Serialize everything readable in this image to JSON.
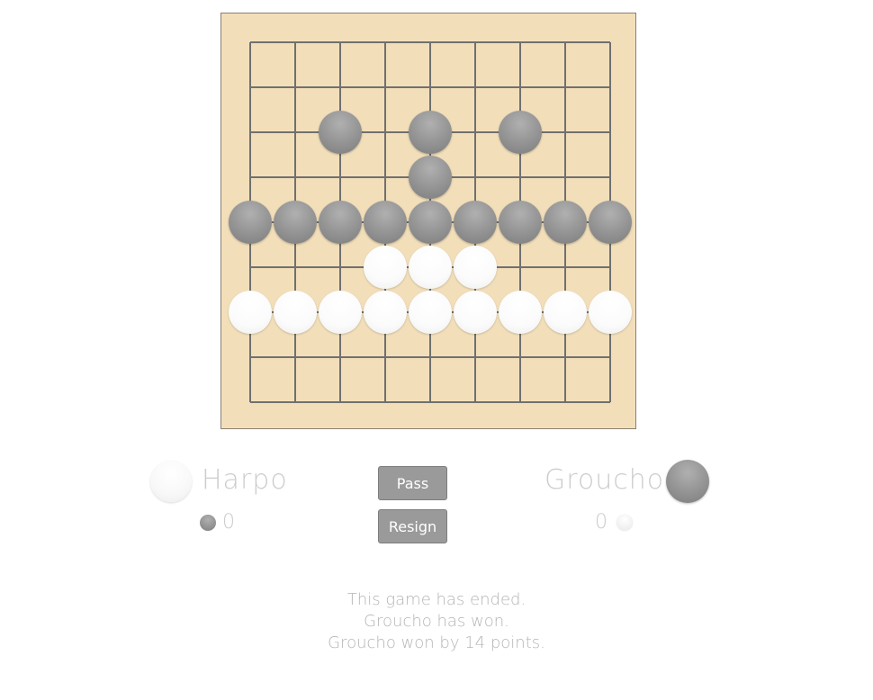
{
  "board": {
    "size": 9,
    "background": "#f2dfba",
    "line_color": "#707070",
    "stones": [
      {
        "row": 2,
        "col": 2,
        "color": "black"
      },
      {
        "row": 2,
        "col": 4,
        "color": "black"
      },
      {
        "row": 2,
        "col": 6,
        "color": "black"
      },
      {
        "row": 3,
        "col": 4,
        "color": "black"
      },
      {
        "row": 4,
        "col": 0,
        "color": "black"
      },
      {
        "row": 4,
        "col": 1,
        "color": "black"
      },
      {
        "row": 4,
        "col": 2,
        "color": "black"
      },
      {
        "row": 4,
        "col": 3,
        "color": "black"
      },
      {
        "row": 4,
        "col": 4,
        "color": "black"
      },
      {
        "row": 4,
        "col": 5,
        "color": "black"
      },
      {
        "row": 4,
        "col": 6,
        "color": "black"
      },
      {
        "row": 4,
        "col": 7,
        "color": "black"
      },
      {
        "row": 4,
        "col": 8,
        "color": "black"
      },
      {
        "row": 5,
        "col": 3,
        "color": "white"
      },
      {
        "row": 5,
        "col": 4,
        "color": "white"
      },
      {
        "row": 5,
        "col": 5,
        "color": "white"
      },
      {
        "row": 6,
        "col": 0,
        "color": "white"
      },
      {
        "row": 6,
        "col": 1,
        "color": "white"
      },
      {
        "row": 6,
        "col": 2,
        "color": "white"
      },
      {
        "row": 6,
        "col": 3,
        "color": "white"
      },
      {
        "row": 6,
        "col": 4,
        "color": "white"
      },
      {
        "row": 6,
        "col": 5,
        "color": "white"
      },
      {
        "row": 6,
        "col": 6,
        "color": "white"
      },
      {
        "row": 6,
        "col": 7,
        "color": "white"
      },
      {
        "row": 6,
        "col": 8,
        "color": "white"
      }
    ]
  },
  "players": {
    "white": {
      "name": "Harpo",
      "captures": "0"
    },
    "black": {
      "name": "Groucho",
      "captures": "0"
    }
  },
  "controls": {
    "pass_label": "Pass",
    "resign_label": "Resign"
  },
  "status": {
    "line1": "This game has ended.",
    "line2": "Groucho has won.",
    "line3": "Groucho won by 14 points."
  }
}
